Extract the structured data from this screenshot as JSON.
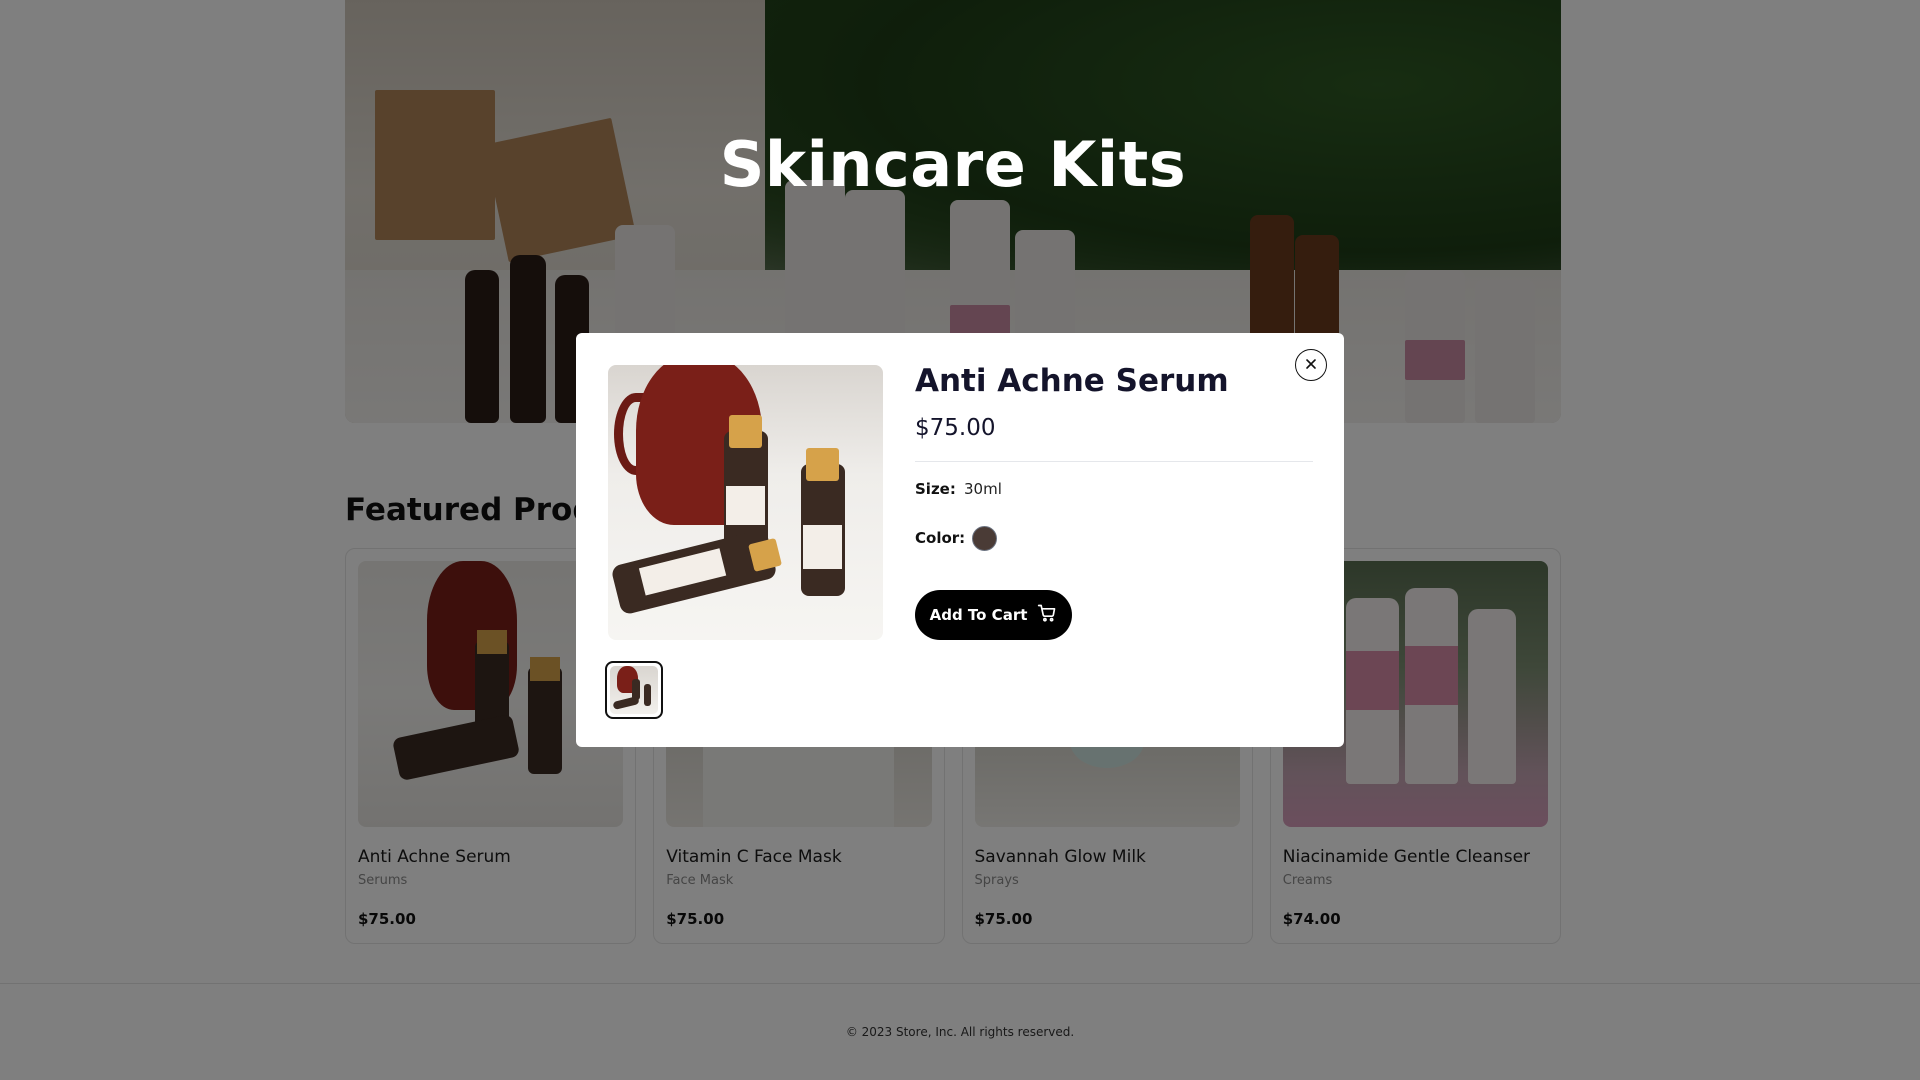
{
  "hero": {
    "title": "Skincare Kits"
  },
  "featured": {
    "title": "Featured Products",
    "products": [
      {
        "name": "Anti Achne Serum",
        "category": "Serums",
        "price": "$75.00"
      },
      {
        "name": "Vitamin C Face Mask",
        "category": "Face Mask",
        "price": "$75.00"
      },
      {
        "name": "Savannah Glow Milk",
        "category": "Sprays",
        "price": "$75.00"
      },
      {
        "name": "Niacinamide Gentle Cleanser",
        "category": "Creams",
        "price": "$74.00"
      }
    ]
  },
  "footer": {
    "copyright": "© 2023 Store, Inc. All rights reserved."
  },
  "modal": {
    "title": "Anti Achne Serum",
    "price": "$75.00",
    "size_label": "Size:",
    "size_value": "30ml",
    "color_label": "Color:",
    "color_value": "#4a3b36",
    "add_to_cart_label": "Add To Cart",
    "icons": {
      "close": "close-icon",
      "cart": "cart-icon"
    }
  }
}
